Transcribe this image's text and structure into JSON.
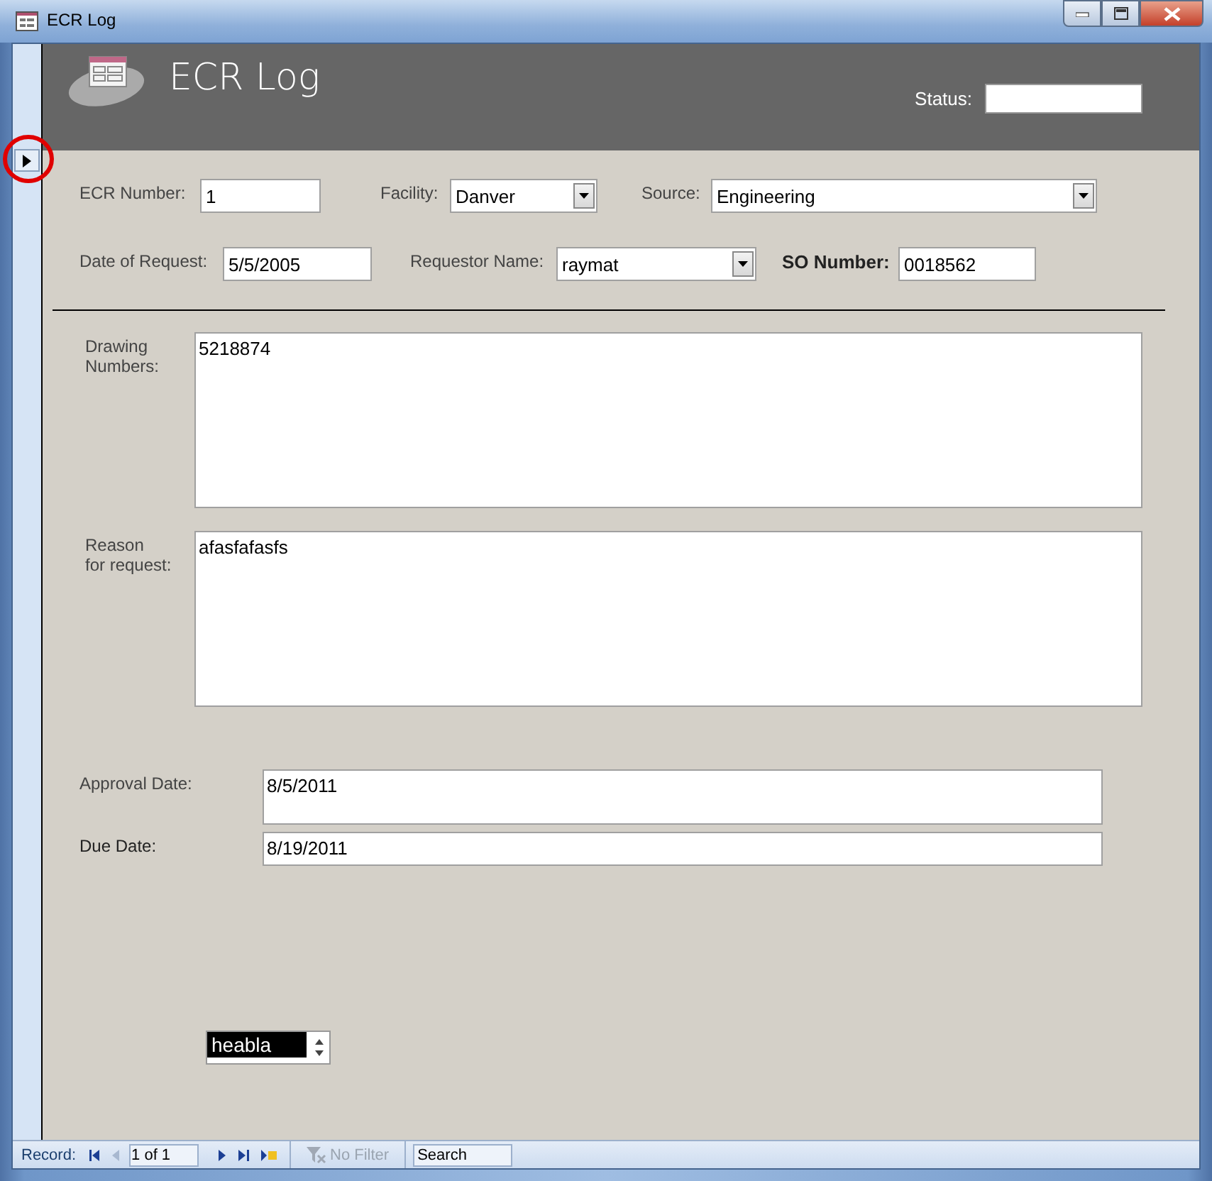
{
  "window": {
    "title": "ECR Log"
  },
  "header": {
    "title": "ECR Log",
    "status_label": "Status:"
  },
  "rows": [
    [
      {
        "label": "ECR Number:",
        "value": "1",
        "kind": "text",
        "bold": false
      },
      {
        "label": "Facility:",
        "value": "Danver",
        "kind": "combo",
        "bold": false
      },
      {
        "label": "Source:",
        "value": "Engineering",
        "kind": "combo",
        "bold": false
      }
    ],
    [
      {
        "label": "Date of Request:",
        "value": "5/5/2005",
        "kind": "text",
        "bold": false
      },
      {
        "label": "Requestor Name:",
        "value": "raymat",
        "kind": "combo",
        "bold": false
      },
      {
        "label": "SO Number:",
        "value": "0018562",
        "kind": "text",
        "bold": true
      }
    ]
  ],
  "memos": [
    {
      "label_lines": [
        "Drawing",
        "Numbers:"
      ],
      "value": "5218874"
    },
    {
      "label_lines": [
        "Reason",
        "for request:"
      ],
      "value": "afasfafasfs"
    }
  ],
  "dates": [
    {
      "label": "Approval Date:",
      "value": "8/5/2011"
    },
    {
      "label": "Due Date:",
      "value": "8/19/2011"
    }
  ],
  "spin": {
    "value": "heabla"
  },
  "status_bar": {
    "record_label": "Record:",
    "position": "1 of 1",
    "filter": "No Filter",
    "filter_enabled": false,
    "search_placeholder": "Search"
  }
}
